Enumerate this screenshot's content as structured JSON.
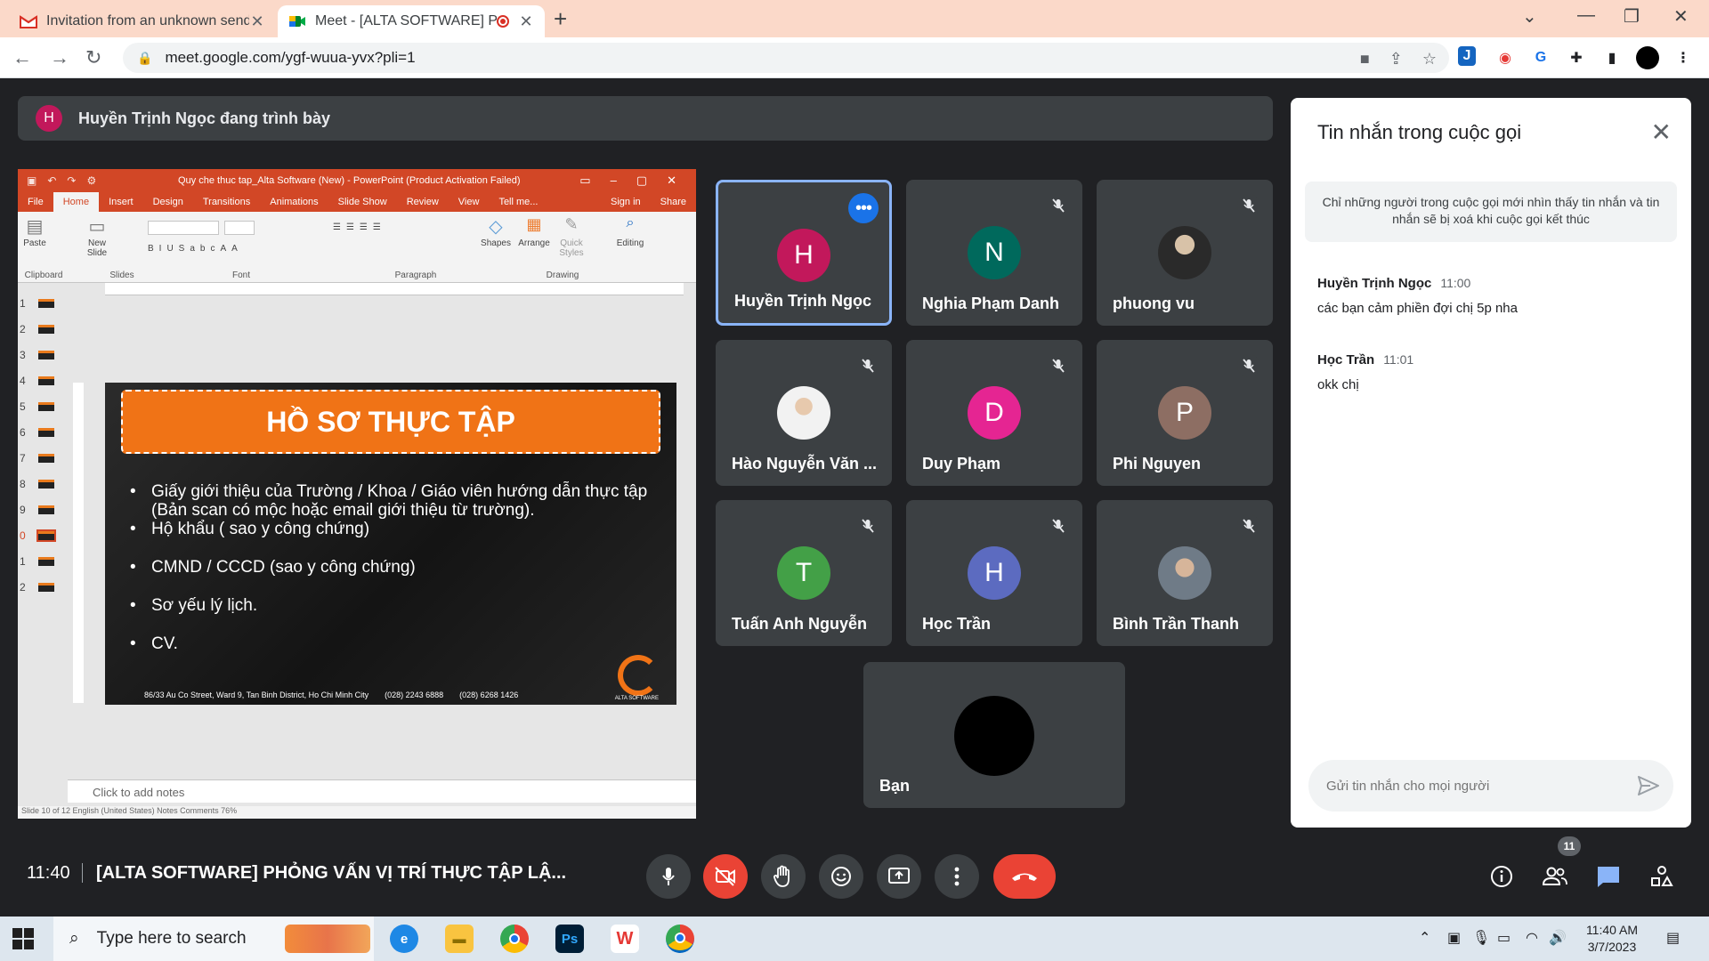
{
  "browser": {
    "tabs": [
      {
        "title": "Invitation from an unknown send",
        "active": false
      },
      {
        "title": "Meet - [ALTA SOFTWARE] PH",
        "active": true
      }
    ],
    "url": "meet.google.com/ygf-wuua-yvx?pli=1"
  },
  "meet": {
    "presenting_banner": {
      "avatar_letter": "H",
      "text": "Huyền Trịnh Ngọc đang trình bày"
    },
    "presentation": {
      "window_title": "Quy che thuc tap_Alta Software (New) - PowerPoint (Product Activation Failed)",
      "ribbon_tabs": [
        "File",
        "Home",
        "Insert",
        "Design",
        "Transitions",
        "Animations",
        "Slide Show",
        "Review",
        "View",
        "Tell me..."
      ],
      "signin": "Sign in",
      "share": "Share",
      "ribbon_groups": [
        "Clipboard",
        "Slides",
        "Font",
        "Paragraph",
        "Drawing"
      ],
      "ribbon_buttons": [
        "Paste",
        "New Slide",
        "Shapes",
        "Arrange",
        "Quick Styles",
        "Editing"
      ],
      "thumbnail_numbers": [
        "1",
        "2",
        "3",
        "4",
        "5",
        "6",
        "7",
        "8",
        "9",
        "0",
        "1",
        "2"
      ],
      "slide": {
        "header": "HỒ SƠ THỰC TẬP",
        "bullets": [
          "Giấy giới thiệu của Trường / Khoa / Giáo viên hướng dẫn thực tập (Bản scan có mộc hoặc email giới thiệu từ trường).",
          "Hộ khẩu ( sao y công chứng)",
          "CMND / CCCD (sao y công chứng)",
          "Sơ yếu lý lịch.",
          "CV."
        ],
        "footer_address": "86/33 Au Co Street, Ward 9, Tan Binh District, Ho Chi Minh City",
        "footer_phone": "(028) 2243 6888",
        "footer_fax": "(028) 6268 1426",
        "logo_text": "ALTA SOFTWARE"
      },
      "notes_placeholder": "Click to add notes",
      "statusbar": "Slide 10 of 12     English (United States)                     Notes    Comments                                   76%"
    },
    "participants": [
      {
        "name": "Huyền Trịnh Ngọc",
        "initial": "H",
        "color": "#c2185b",
        "speaking": true,
        "muted": false
      },
      {
        "name": "Nghia Phạm Danh",
        "initial": "N",
        "color": "#00695c",
        "speaking": false,
        "muted": true
      },
      {
        "name": "phuong vu",
        "initial": "",
        "color": "",
        "speaking": false,
        "muted": true
      },
      {
        "name": "Hào Nguyễn Văn ...",
        "initial": "",
        "color": "",
        "speaking": false,
        "muted": true
      },
      {
        "name": "Duy Phạm",
        "initial": "D",
        "color": "#e52592",
        "speaking": false,
        "muted": true
      },
      {
        "name": "Phi Nguyen",
        "initial": "P",
        "color": "#8d6e63",
        "speaking": false,
        "muted": true
      },
      {
        "name": "Tuấn Anh Nguyễn",
        "initial": "T",
        "color": "#43a047",
        "speaking": false,
        "muted": true
      },
      {
        "name": "Học Trần",
        "initial": "H",
        "color": "#5c6bc0",
        "speaking": false,
        "muted": true
      },
      {
        "name": "Bình Trần Thanh",
        "initial": "",
        "color": "",
        "speaking": false,
        "muted": true
      },
      {
        "name": "Bạn",
        "initial": "",
        "color": "#000000",
        "speaking": false,
        "muted": false
      }
    ],
    "chat": {
      "title": "Tin nhắn trong cuộc gọi",
      "info": "Chỉ những người trong cuộc gọi mới nhìn thấy tin nhắn và tin nhắn sẽ bị xoá khi cuộc gọi kết thúc",
      "messages": [
        {
          "sender": "Huyền Trịnh Ngọc",
          "time": "11:00",
          "text": "các bạn cảm phiền đợi chị 5p nha"
        },
        {
          "sender": "Học Trần",
          "time": "11:01",
          "text": "okk chị"
        }
      ],
      "input_placeholder": "Gửi tin nhắn cho mọi người"
    },
    "bottom_bar": {
      "time": "11:40",
      "meeting_title": "[ALTA SOFTWARE] PHỎNG VẤN VỊ TRÍ THỰC TẬP LẬ...",
      "participant_count": "11"
    }
  },
  "taskbar": {
    "search_placeholder": "Type here to search",
    "time": "11:40 AM",
    "date": "3/7/2023"
  },
  "colors": {
    "meet_bg": "#202124",
    "tile_bg": "#3c4043",
    "end_call": "#ea4335",
    "accent": "#1a73e8",
    "ppt_orange": "#d24726"
  }
}
